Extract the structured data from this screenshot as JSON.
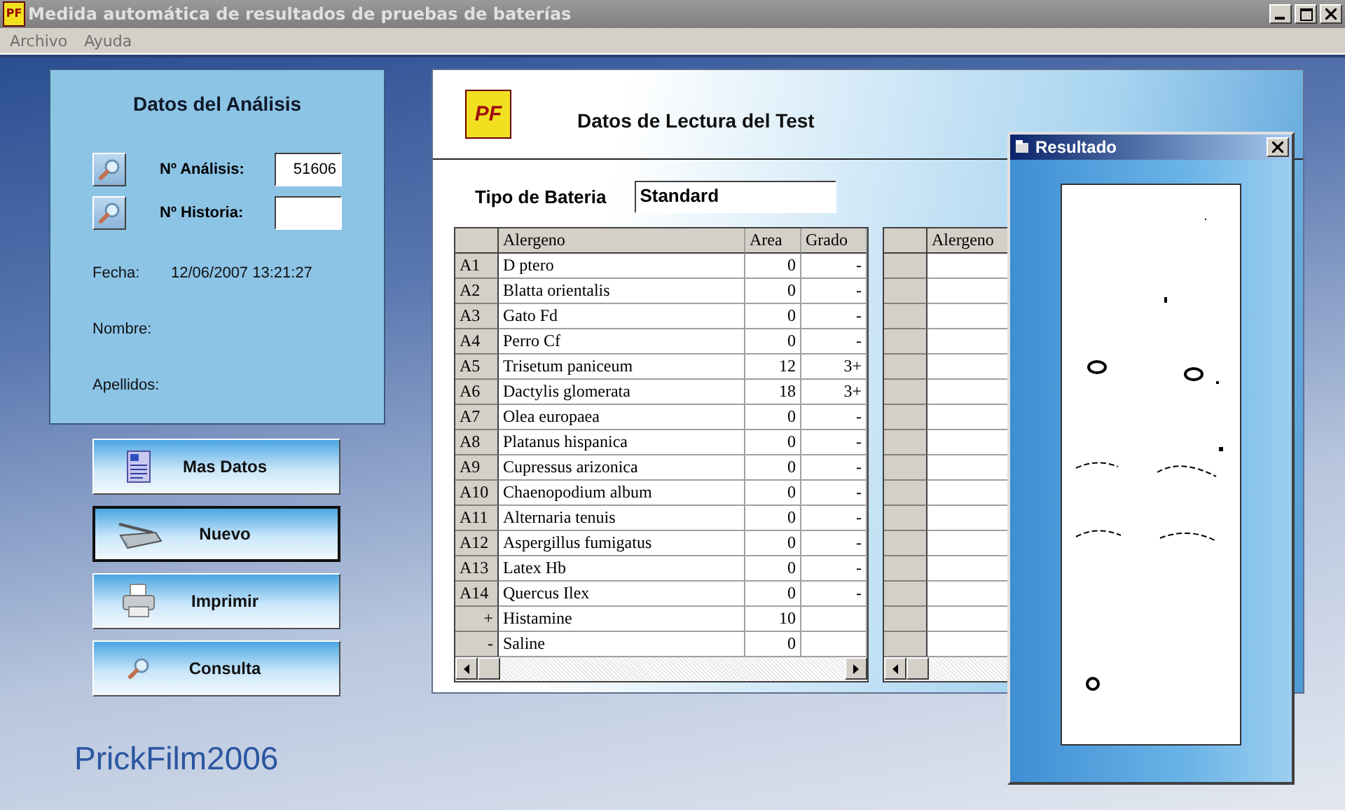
{
  "window": {
    "icon": "PF",
    "title": "Medida automática de resultados de pruebas de baterías"
  },
  "menu": [
    "Archivo",
    "Ayuda"
  ],
  "analysis_panel": {
    "title": "Datos del Análisis",
    "fields": [
      {
        "label": "Nº Análisis:",
        "value": "51606"
      },
      {
        "label": "Nº Historia:"
      }
    ],
    "info": [
      {
        "label": "Fecha:",
        "value": "12/06/2007 13:21:27"
      },
      {
        "label": "Nombre:"
      },
      {
        "label": "Apellidos:"
      }
    ]
  },
  "buttons": [
    {
      "label": "Mas Datos",
      "focused": false
    },
    {
      "label": "Nuevo",
      "focused": true
    },
    {
      "label": "Imprimir",
      "focused": false
    },
    {
      "label": "Consulta",
      "focused": false
    }
  ],
  "brand": "PrickFilm2006",
  "test_panel": {
    "logo": "PF",
    "title": "Datos de Lectura del Test",
    "battery_label": "Tipo de Bateria",
    "battery_value": "Standard",
    "table": {
      "columns": [
        "Alergeno",
        "Area",
        "Grado"
      ],
      "rows": [
        {
          "kind": "allergen",
          "header": "A1",
          "alergeno": "D ptero",
          "area": "0",
          "grado": "-"
        },
        {
          "kind": "allergen",
          "header": "A2",
          "alergeno": "Blatta orientalis",
          "area": "0",
          "grado": "-"
        },
        {
          "kind": "allergen",
          "header": "A3",
          "alergeno": "Gato Fd",
          "area": "0",
          "grado": "-"
        },
        {
          "kind": "allergen",
          "header": "A4",
          "alergeno": "Perro Cf",
          "area": "0",
          "grado": "-"
        },
        {
          "kind": "allergen",
          "header": "A5",
          "alergeno": "Trisetum paniceum",
          "area": "12",
          "grado": "3+"
        },
        {
          "kind": "allergen",
          "header": "A6",
          "alergeno": "Dactylis glomerata",
          "area": "18",
          "grado": "3+"
        },
        {
          "kind": "allergen",
          "header": "A7",
          "alergeno": "Olea europaea",
          "area": "0",
          "grado": "-"
        },
        {
          "kind": "allergen",
          "header": "A8",
          "alergeno": "Platanus hispanica",
          "area": "0",
          "grado": "-"
        },
        {
          "kind": "allergen",
          "header": "A9",
          "alergeno": "Cupressus arizonica",
          "area": "0",
          "grado": "-"
        },
        {
          "kind": "allergen",
          "header": "A10",
          "alergeno": "Chaenopodium album",
          "area": "0",
          "grado": "-"
        },
        {
          "kind": "allergen",
          "header": "A11",
          "alergeno": "Alternaria tenuis",
          "area": "0",
          "grado": "-"
        },
        {
          "kind": "allergen",
          "header": "A12",
          "alergeno": "Aspergillus fumigatus",
          "area": "0",
          "grado": "-"
        },
        {
          "kind": "allergen",
          "header": "A13",
          "alergeno": "Latex Hb",
          "area": "0",
          "grado": "-"
        },
        {
          "kind": "allergen",
          "header": "A14",
          "alergeno": "Quercus Ilex",
          "area": "0",
          "grado": "-"
        },
        {
          "kind": "control",
          "header": "+",
          "alergeno": "Histamine",
          "area": "10"
        },
        {
          "kind": "control",
          "header": "-",
          "alergeno": "Saline",
          "area": "0"
        }
      ]
    },
    "table_2": {
      "columns": [
        "Alergeno"
      ]
    }
  },
  "result_window": {
    "title": "Resultado"
  }
}
